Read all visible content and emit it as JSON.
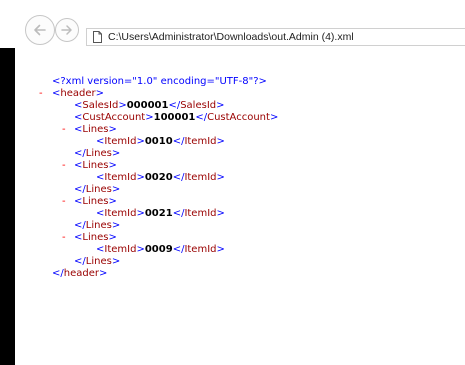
{
  "toolbar": {
    "address": "C:\\Users\\Administrator\\Downloads\\out.Admin (4).xml"
  },
  "xml": {
    "declaration": "<?xml version=\"1.0\" encoding=\"UTF-8\"?>",
    "collapse_symbol": "-",
    "open_bracket": "<",
    "close_bracket": ">",
    "end_bracket": "</",
    "root_tag": "header",
    "sales_id_tag": "SalesId",
    "sales_id_value": "000001",
    "cust_account_tag": "CustAccount",
    "cust_account_value": "100001",
    "lines_tag": "Lines",
    "item_id_tag": "ItemId",
    "lines": [
      {
        "item_id": "0010"
      },
      {
        "item_id": "0020"
      },
      {
        "item_id": "0021"
      },
      {
        "item_id": "0009"
      }
    ]
  }
}
